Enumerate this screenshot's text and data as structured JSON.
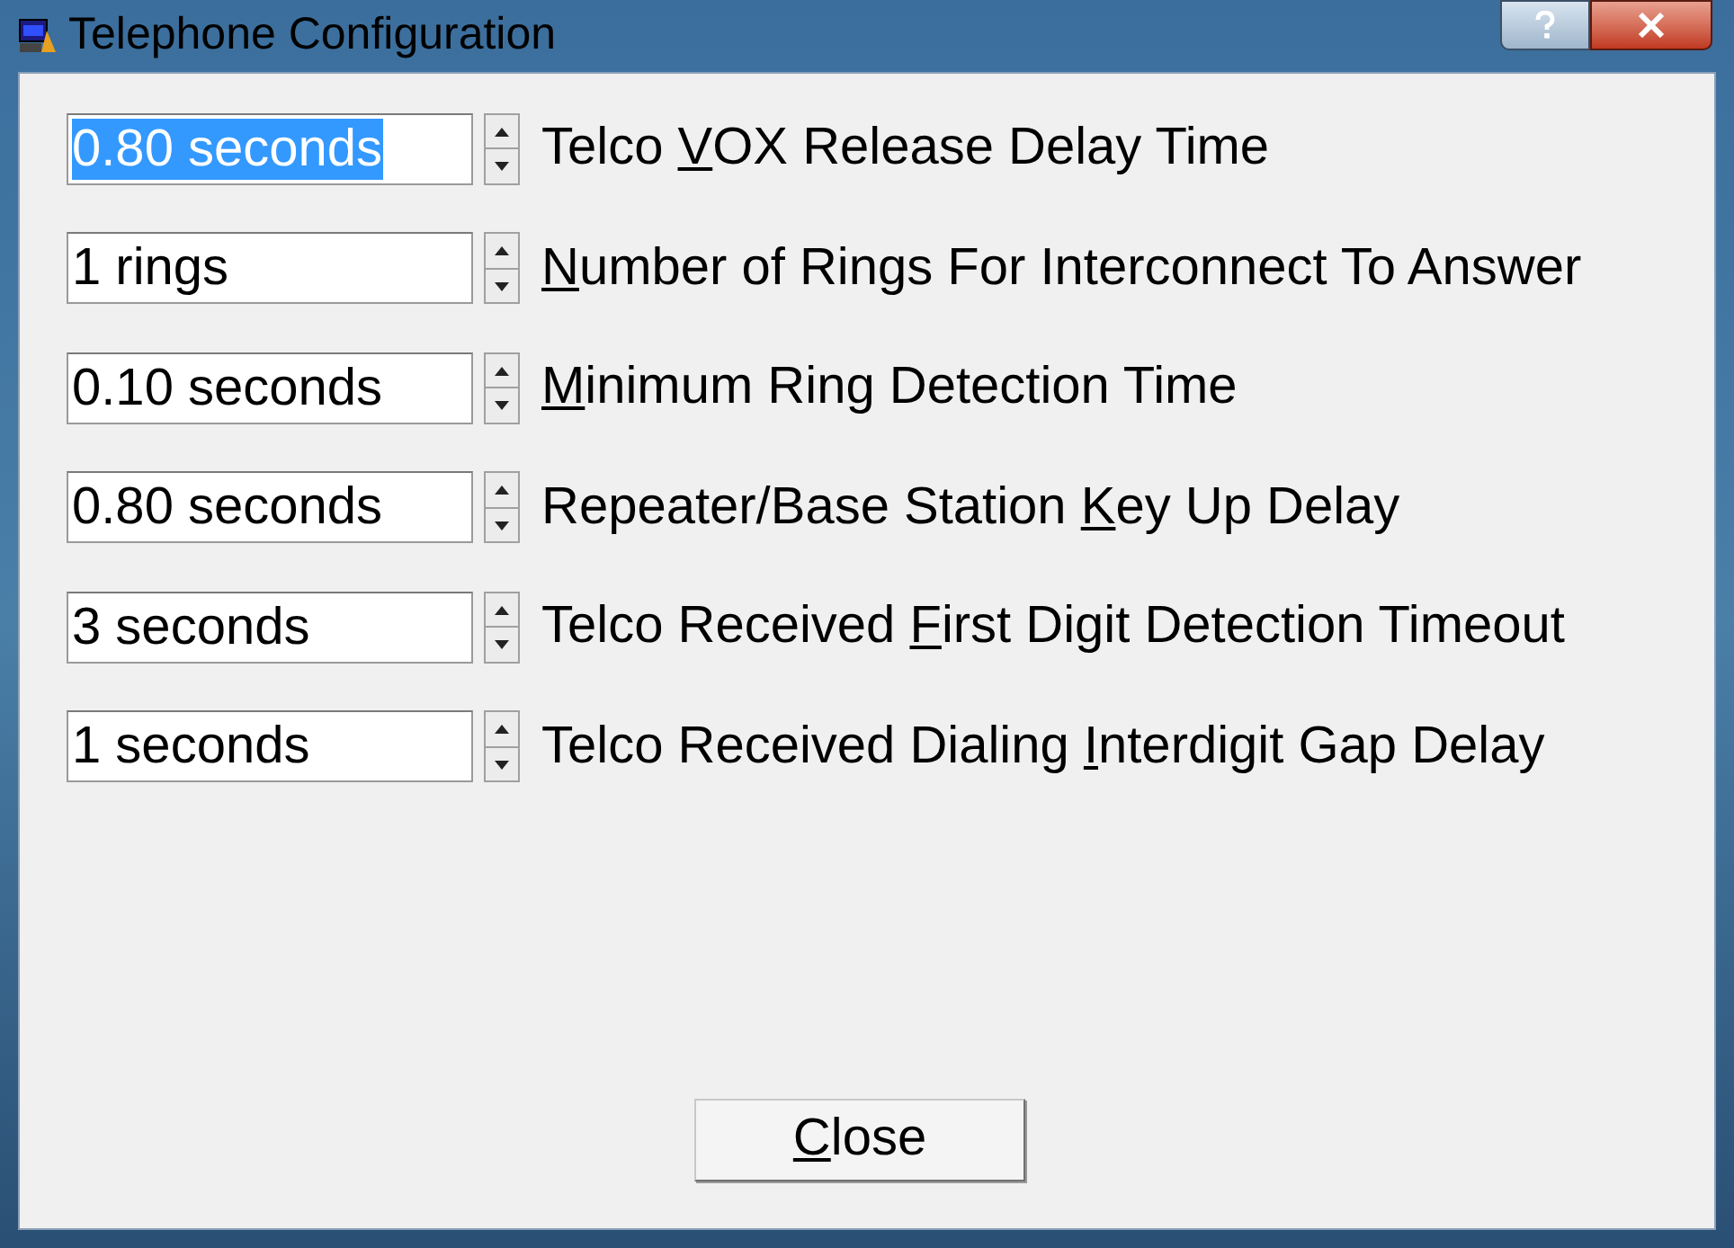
{
  "window": {
    "title": "Telephone Configuration"
  },
  "settings": [
    {
      "value": "0.80 seconds",
      "selected": true,
      "label": [
        {
          "text": "Telco ",
          "underlined": false
        },
        {
          "text": "V",
          "underlined": true
        },
        {
          "text": "OX Release Delay Time",
          "underlined": false
        }
      ]
    },
    {
      "value": "1 rings",
      "selected": false,
      "label": [
        {
          "text": "N",
          "underlined": true
        },
        {
          "text": "umber of Rings For Interconnect To Answer",
          "underlined": false
        }
      ]
    },
    {
      "value": "0.10 seconds",
      "selected": false,
      "label": [
        {
          "text": "M",
          "underlined": true
        },
        {
          "text": "inimum Ring Detection Time",
          "underlined": false
        }
      ]
    },
    {
      "value": "0.80 seconds",
      "selected": false,
      "label": [
        {
          "text": "Repeater/Base Station ",
          "underlined": false
        },
        {
          "text": "K",
          "underlined": true
        },
        {
          "text": "ey Up Delay",
          "underlined": false
        }
      ]
    },
    {
      "value": "3 seconds",
      "selected": false,
      "label": [
        {
          "text": "Telco Received ",
          "underlined": false
        },
        {
          "text": "F",
          "underlined": true
        },
        {
          "text": "irst Digit Detection Timeout",
          "underlined": false
        }
      ]
    },
    {
      "value": "1 seconds",
      "selected": false,
      "label": [
        {
          "text": "Telco Received Dialing ",
          "underlined": false
        },
        {
          "text": "I",
          "underlined": true
        },
        {
          "text": "nterdigit Gap Delay",
          "underlined": false
        }
      ]
    }
  ],
  "close_button": {
    "label": [
      {
        "text": "C",
        "underlined": true
      },
      {
        "text": "lose",
        "underlined": false
      }
    ]
  }
}
